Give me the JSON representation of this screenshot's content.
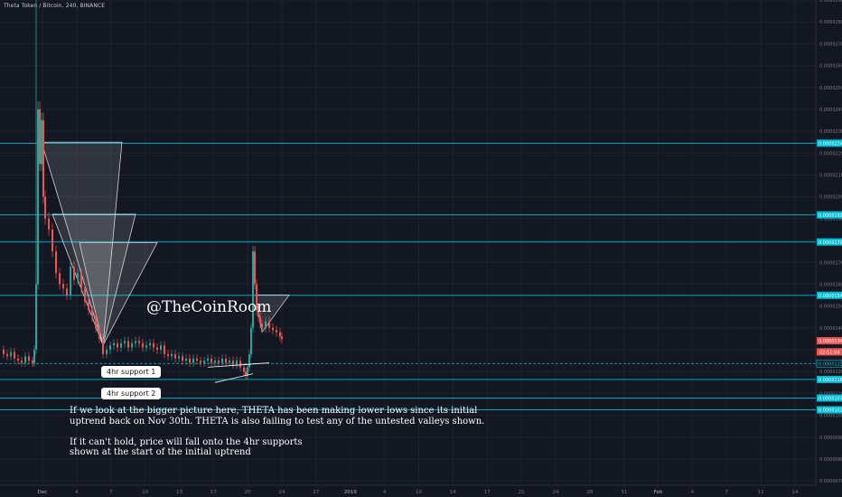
{
  "header": {
    "title": "Theta Token / Bitcoin, 240, BINANCE"
  },
  "watermark": "@TheCoinRoom",
  "callouts": {
    "support1": "4hr support 1",
    "support2": "4hr support 2"
  },
  "commentary": {
    "line1": "If we look at the bigger picture here, THETA has been making lower lows since its initial",
    "line2": "uptrend back on Nov 30th. THETA is also failing to test any of the untested valleys shown.",
    "line3": "If it can't hold, price will fall onto the 4hr supports",
    "line4": "shown at the start of the initial uptrend"
  },
  "colors": {
    "background": "#131722",
    "grid": "#1e2230",
    "up": "#26a69a",
    "down": "#ef5350",
    "level": "#00bcd4",
    "axis_text": "#787b86",
    "triangle": "#ffffff"
  },
  "chart_data": {
    "type": "candlestick",
    "title": "Theta Token / Bitcoin, 240, BINANCE",
    "y_ticks": [
      "0.00002900",
      "0.00002800",
      "0.00002700",
      "0.00002600",
      "0.00002500",
      "0.00002400",
      "0.00002300",
      "0.00002200",
      "0.00002100",
      "0.00002000",
      "0.00001900",
      "0.00001800",
      "0.00001700",
      "0.00001600",
      "0.00001500",
      "0.00001400",
      "0.00001300",
      "0.00001200",
      "0.00001100",
      "0.00001000",
      "0.00000900",
      "0.00000800",
      "0.00000700"
    ],
    "ylim": [
      6.8e-06,
      2.9e-05
    ],
    "x_ticks": [
      "Dec",
      "4",
      "7",
      "10",
      "13",
      "17",
      "20",
      "24",
      "27",
      "2019",
      "4",
      "10",
      "14",
      "17",
      "21",
      "24",
      "28",
      "31",
      "Feb",
      "4",
      "7",
      "11",
      "14"
    ],
    "price_labels": [
      {
        "value": 2.245e-05,
        "label": "0.00002245"
      },
      {
        "value": 1.917e-05,
        "label": "0.00001917"
      },
      {
        "value": 1.793e-05,
        "label": "0.00001793"
      },
      {
        "value": 1.549e-05,
        "label": "0.00001549"
      },
      {
        "value": 1.341e-05,
        "label": "0.00001341"
      },
      {
        "value": 1.237e-05,
        "label": "0.00001237"
      },
      {
        "value": 1.164e-05,
        "label": "0.00001164"
      },
      {
        "value": 1.079e-05,
        "label": "0.00001079"
      },
      {
        "value": 1.025e-05,
        "label": "0.00001025"
      }
    ],
    "current_price": {
      "value": 1.341e-05,
      "label": "0.00001341"
    },
    "countdown": {
      "value": 1.29e-05,
      "label": "02:51:04"
    },
    "levels": [
      2.245e-05,
      1.917e-05,
      1.793e-05,
      1.549e-05,
      1.164e-05,
      1.079e-05,
      1.025e-05
    ],
    "dashed_level": 1.237e-05,
    "close_path": [
      [
        0,
        1.3e-05
      ],
      [
        4,
        1.28e-05
      ],
      [
        8,
        1.27e-05
      ],
      [
        12,
        1.29e-05
      ],
      [
        16,
        1.26e-05
      ],
      [
        20,
        1.25e-05
      ],
      [
        24,
        1.24e-05
      ],
      [
        28,
        1.27e-05
      ],
      [
        32,
        1.25e-05
      ],
      [
        36,
        1.24e-05
      ],
      [
        38,
        1.3e-05
      ],
      [
        40,
        1.6e-05
      ],
      [
        42,
        2.4e-05
      ],
      [
        44,
        2.15e-05
      ],
      [
        46,
        2.35e-05
      ],
      [
        48,
        2e-05
      ],
      [
        50,
        1.9e-05
      ],
      [
        54,
        1.85e-05
      ],
      [
        58,
        1.75e-05
      ],
      [
        62,
        1.65e-05
      ],
      [
        66,
        1.6e-05
      ],
      [
        70,
        1.58e-05
      ],
      [
        74,
        1.55e-05
      ],
      [
        78,
        1.68e-05
      ],
      [
        82,
        1.62e-05
      ],
      [
        86,
        1.65e-05
      ],
      [
        90,
        1.58e-05
      ],
      [
        94,
        1.52e-05
      ],
      [
        98,
        1.48e-05
      ],
      [
        102,
        1.45e-05
      ],
      [
        106,
        1.4e-05
      ],
      [
        110,
        1.35e-05
      ],
      [
        114,
        1.28e-05
      ],
      [
        118,
        1.3e-05
      ],
      [
        122,
        1.32e-05
      ],
      [
        126,
        1.33e-05
      ],
      [
        130,
        1.31e-05
      ],
      [
        134,
        1.33e-05
      ],
      [
        138,
        1.34e-05
      ],
      [
        142,
        1.31e-05
      ],
      [
        146,
        1.33e-05
      ],
      [
        150,
        1.34e-05
      ],
      [
        154,
        1.33e-05
      ],
      [
        158,
        1.31e-05
      ],
      [
        162,
        1.32e-05
      ],
      [
        166,
        1.33e-05
      ],
      [
        170,
        1.31e-05
      ],
      [
        174,
        1.3e-05
      ],
      [
        178,
        1.32e-05
      ],
      [
        182,
        1.28e-05
      ],
      [
        186,
        1.27e-05
      ],
      [
        190,
        1.28e-05
      ],
      [
        194,
        1.26e-05
      ],
      [
        198,
        1.27e-05
      ],
      [
        202,
        1.25e-05
      ],
      [
        206,
        1.26e-05
      ],
      [
        210,
        1.24e-05
      ],
      [
        214,
        1.26e-05
      ],
      [
        218,
        1.25e-05
      ],
      [
        222,
        1.24e-05
      ],
      [
        226,
        1.25e-05
      ],
      [
        230,
        1.26e-05
      ],
      [
        234,
        1.24e-05
      ],
      [
        238,
        1.25e-05
      ],
      [
        242,
        1.24e-05
      ],
      [
        246,
        1.26e-05
      ],
      [
        250,
        1.24e-05
      ],
      [
        254,
        1.25e-05
      ],
      [
        258,
        1.23e-05
      ],
      [
        262,
        1.25e-05
      ],
      [
        266,
        1.22e-05
      ],
      [
        270,
        1.2e-05
      ],
      [
        272,
        1.18e-05
      ],
      [
        274,
        1.22e-05
      ],
      [
        276,
        1.28e-05
      ],
      [
        278,
        1.4e-05
      ],
      [
        280,
        1.75e-05
      ],
      [
        282,
        1.6e-05
      ],
      [
        284,
        1.48e-05
      ],
      [
        286,
        1.45e-05
      ],
      [
        288,
        1.42e-05
      ],
      [
        290,
        1.4e-05
      ],
      [
        294,
        1.43e-05
      ],
      [
        298,
        1.4e-05
      ],
      [
        302,
        1.39e-05
      ],
      [
        306,
        1.38e-05
      ],
      [
        310,
        1.36e-05
      ],
      [
        312,
        1.35e-05
      ]
    ],
    "spikes": [
      [
        40,
        2.9e-05
      ],
      [
        44,
        2.37e-05
      ],
      [
        280,
        1.75e-05
      ]
    ],
    "triangles": [
      [
        [
          46,
          2.25e-05
        ],
        [
          135,
          2.25e-05
        ],
        [
          114,
          1.32e-05
        ]
      ],
      [
        [
          58,
          1.92e-05
        ],
        [
          150,
          1.92e-05
        ],
        [
          114,
          1.32e-05
        ]
      ],
      [
        [
          88,
          1.79e-05
        ],
        [
          174,
          1.79e-05
        ],
        [
          114,
          1.32e-05
        ]
      ],
      [
        [
          283,
          1.55e-05
        ],
        [
          320,
          1.55e-05
        ],
        [
          290,
          1.38e-05
        ]
      ]
    ],
    "support_lines": [
      [
        [
          230,
          1.22e-05
        ],
        [
          298,
          1.24e-05
        ]
      ],
      [
        [
          238,
          1.15e-05
        ],
        [
          280,
          1.19e-05
        ]
      ]
    ]
  }
}
